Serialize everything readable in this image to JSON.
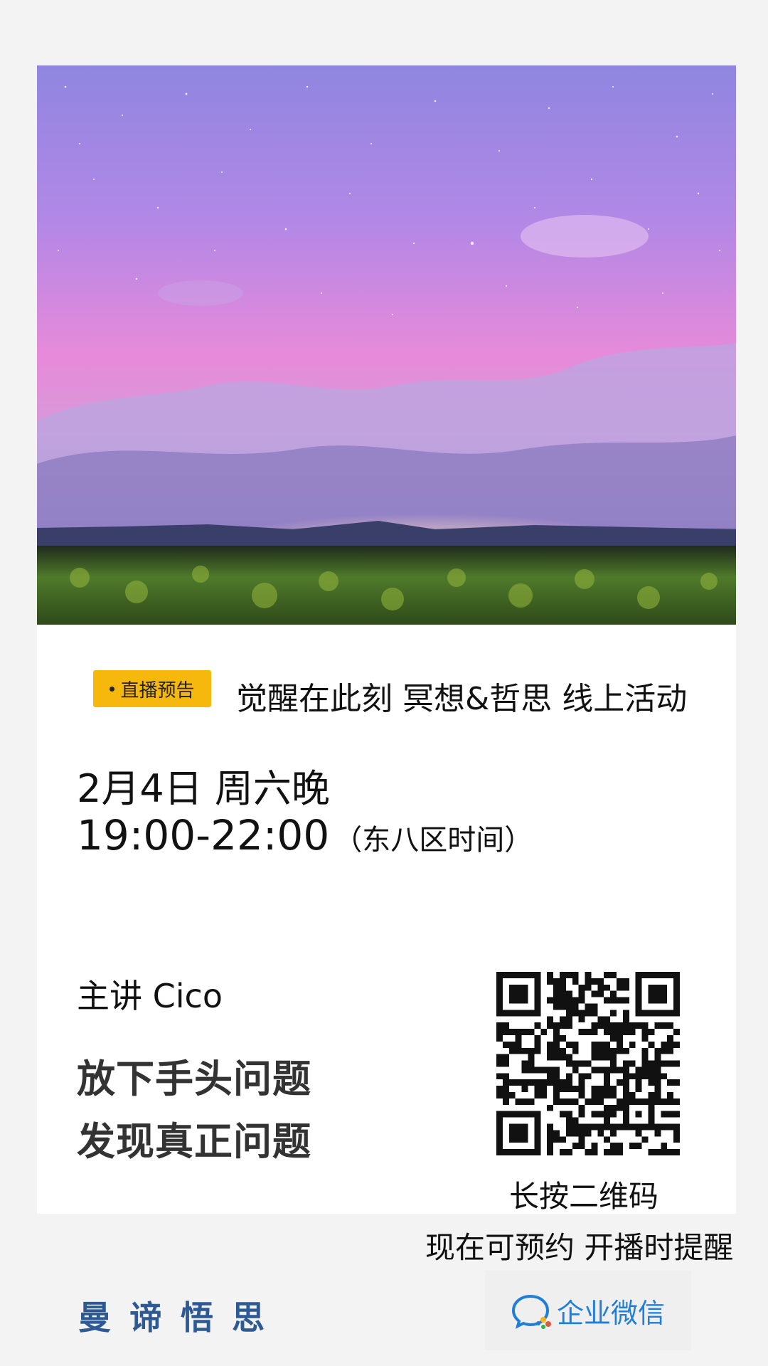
{
  "badge": {
    "label": "直播预告"
  },
  "event": {
    "title": "觉醒在此刻 冥想&哲思 线上活动"
  },
  "schedule": {
    "date": "2月4日 周六晚",
    "time": "19:00-22:00",
    "timezone": "（东八区时间）"
  },
  "speaker": {
    "label": "主讲 Cico"
  },
  "slogan": {
    "line1": "放下手头问题",
    "line2": "发现真正问题"
  },
  "qr": {
    "hint": "长按二维码",
    "reserve": "现在可预约 开播时提醒"
  },
  "brand": {
    "name": "曼谛悟思"
  },
  "wecom": {
    "label": "企业微信"
  },
  "colors": {
    "badge": "#f6b80c",
    "brand": "#2d5a94",
    "wecom": "#1f7fd8",
    "page_bg": "#f3f3f3"
  },
  "icons": [
    "hero-photo",
    "qr-code",
    "wecom-logo-icon"
  ]
}
